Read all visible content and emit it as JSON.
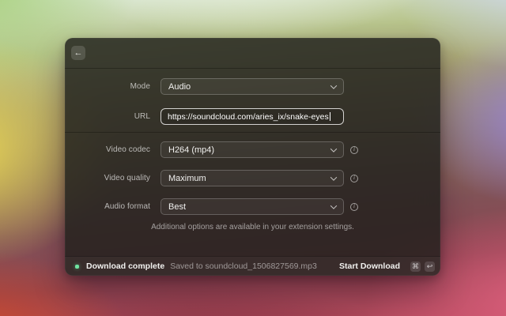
{
  "window": {
    "icons": {
      "back": "←",
      "info": "i",
      "command": "⌘",
      "return": "↩"
    },
    "form": {
      "rows": [
        {
          "label": "Mode",
          "value": "Audio"
        },
        {
          "label": "URL",
          "value": "https://soundcloud.com/aries_ix/snake-eyes"
        },
        {
          "label": "Video codec",
          "value": "H264 (mp4)"
        },
        {
          "label": "Video quality",
          "value": "Maximum"
        },
        {
          "label": "Audio format",
          "value": "Best"
        }
      ],
      "note": "Additional options are available in your extension settings."
    },
    "status_bar": {
      "title": "Download complete",
      "detail": "Saved to soundcloud_1506827569.mp3",
      "action": "Start Download",
      "dot_color": "#6FE3A0"
    }
  }
}
